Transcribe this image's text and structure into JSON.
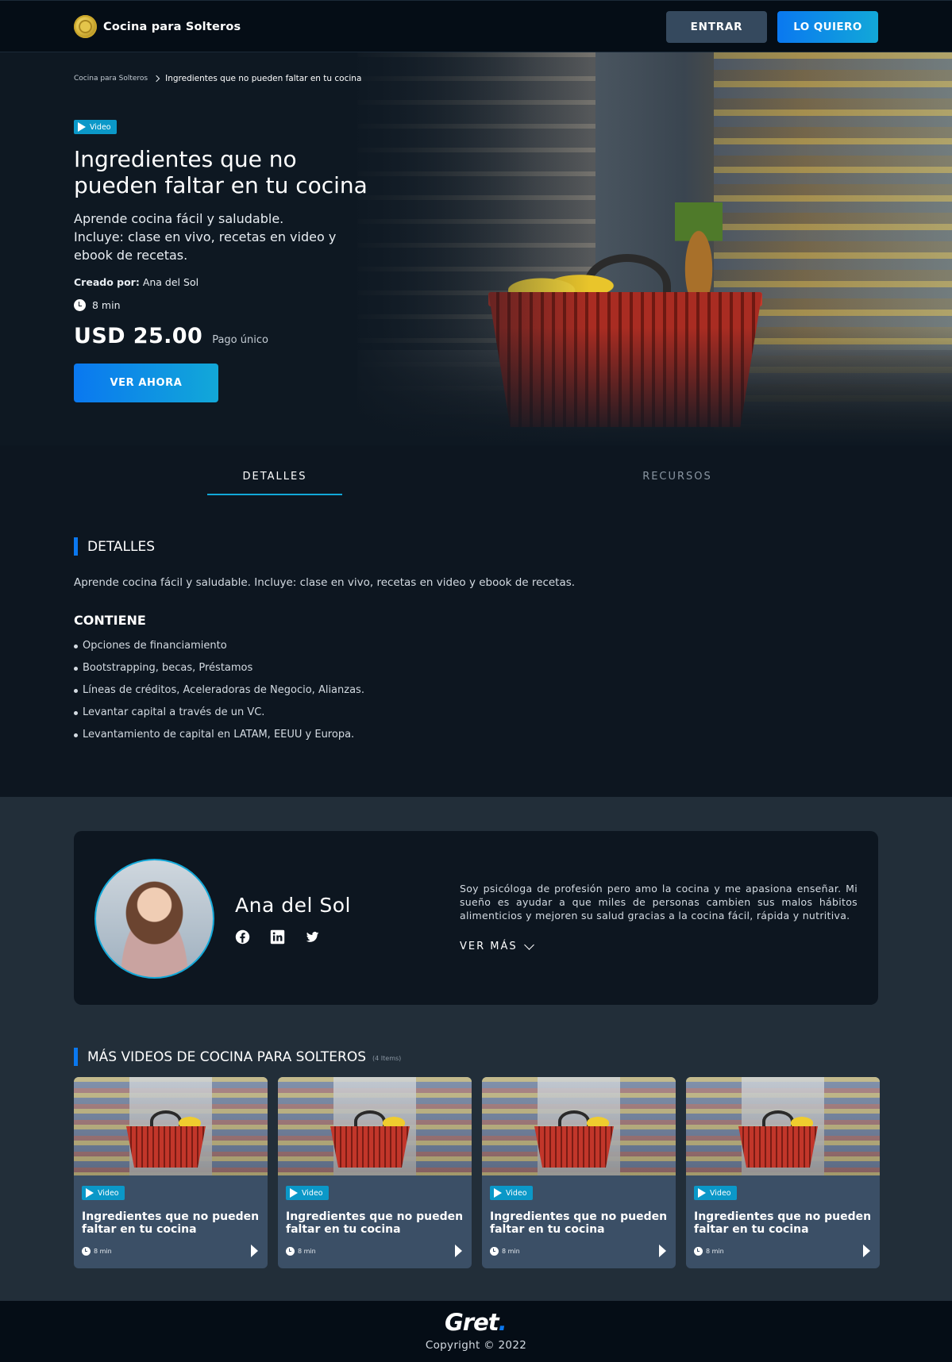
{
  "header": {
    "brand_name": "Cocina para Solteros",
    "login_label": "ENTRAR",
    "cta_label": "LO QUIERO"
  },
  "breadcrumb": {
    "root": "Cocina para Solteros",
    "current": "Ingredientes que no pueden faltar en tu cocina"
  },
  "hero": {
    "badge": "Video",
    "title": "Ingredientes que no pueden faltar en tu cocina",
    "subtitle_line1": "Aprende cocina fácil y saludable.",
    "subtitle_line2": "Incluye: clase en vivo, recetas en video y ebook de recetas.",
    "author_label": "Creado por:",
    "author_name": "Ana del Sol",
    "duration": "8 min",
    "price": "USD 25.00",
    "price_note": "Pago único",
    "watch_label": "VER AHORA"
  },
  "tabs": {
    "details": "DETALLES",
    "resources": "RECURSOS",
    "active": "details"
  },
  "details": {
    "title": "DETALLES",
    "text": "Aprende cocina fácil y saludable. Incluye: clase en vivo, recetas en video y ebook de recetas.",
    "contains_title": "CONTIENE",
    "items": [
      "Opciones de financiamiento",
      "Bootstrapping, becas, Préstamos",
      "Líneas de créditos, Aceleradoras de Negocio, Alianzas.",
      "Levantar capital a través de un VC.",
      "Levantamiento de capital en LATAM, EEUU y Europa."
    ]
  },
  "author": {
    "name": "Ana del Sol",
    "bio": "Soy psicóloga de profesión pero amo la cocina y me apasiona enseñar. Mi sueño es ayudar a que miles de personas cambien sus malos hábitos alimenticios y mejoren su salud gracias a la cocina fácil, rápida y nutritiva.",
    "more_label": "VER MÁS",
    "socials": [
      "facebook-icon",
      "linkedin-icon",
      "twitter-icon"
    ]
  },
  "more_videos": {
    "title": "MÁS VIDEOS DE COCINA PARA SOLTEROS",
    "count": "(4 Items)",
    "cards": [
      {
        "badge": "Video",
        "title": "Ingredientes que no pueden faltar en tu cocina",
        "duration": "8 min"
      },
      {
        "badge": "Video",
        "title": "Ingredientes que no pueden faltar en tu cocina",
        "duration": "8 min"
      },
      {
        "badge": "Video",
        "title": "Ingredientes que no pueden faltar en tu cocina",
        "duration": "8 min"
      },
      {
        "badge": "Video",
        "title": "Ingredientes que no pueden faltar en tu cocina",
        "duration": "8 min"
      }
    ]
  },
  "footer": {
    "logo_text": "Gret",
    "logo_dot": ".",
    "copyright": "Copyright © 2022"
  },
  "colors": {
    "accent_blue": "#0a78f0",
    "accent_cyan": "#12a8d8",
    "background": "#0d1620",
    "card": "#3b4f66"
  }
}
